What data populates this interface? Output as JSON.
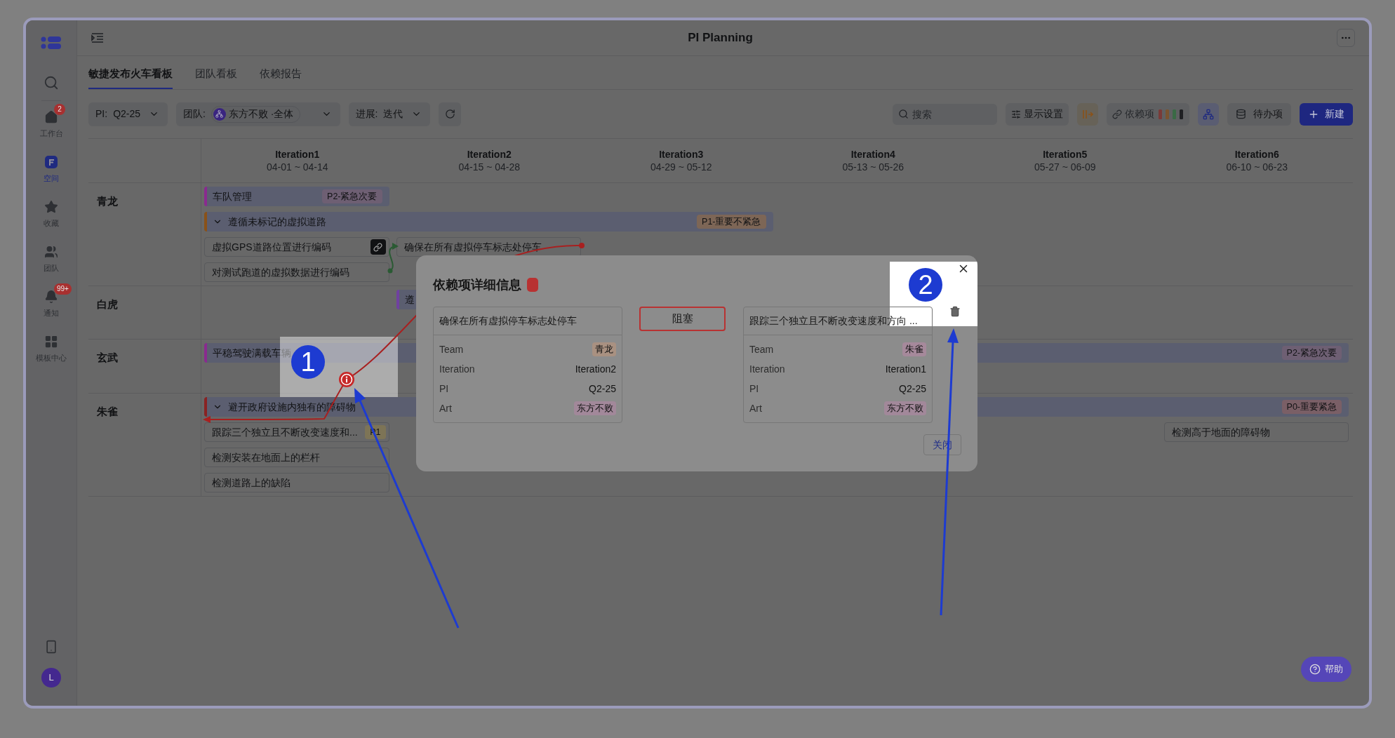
{
  "window": {
    "title": "PI Planning"
  },
  "sidebar": {
    "items": [
      {
        "label": "工作台",
        "badge": "2",
        "selected": false
      },
      {
        "label": "空间",
        "selected": true
      },
      {
        "label": "收藏",
        "selected": false
      },
      {
        "label": "团队",
        "selected": false
      },
      {
        "label": "通知",
        "badge": "99+",
        "selected": false
      },
      {
        "label": "模板中心",
        "selected": false
      }
    ],
    "avatar": "L"
  },
  "tabs": [
    {
      "label": "敏捷发布火车看板",
      "selected": true
    },
    {
      "label": "团队看板",
      "selected": false
    },
    {
      "label": "依赖报告",
      "selected": false
    }
  ],
  "filters": [
    {
      "label": "PI:",
      "value": "Q2-25"
    },
    {
      "label": "团队:",
      "value": "东方不败 ·全体"
    },
    {
      "label": "进展:",
      "value": "迭代"
    }
  ],
  "toolbar": {
    "search": {
      "placeholder": "搜索"
    },
    "buttons": [
      {
        "label": "显示设置"
      },
      {
        "label": "依赖项"
      },
      {
        "label": "待办项"
      },
      {
        "label": "新建"
      }
    ]
  },
  "board": {
    "columns": [
      {
        "name": "Iteration1",
        "dates": "04-01 ~ 04-14"
      },
      {
        "name": "Iteration2",
        "dates": "04-15 ~ 04-28"
      },
      {
        "name": "Iteration3",
        "dates": "04-29 ~ 05-12"
      },
      {
        "name": "Iteration4",
        "dates": "05-13 ~ 05-26"
      },
      {
        "name": "Iteration5",
        "dates": "05-27 ~ 06-09"
      },
      {
        "name": "Iteration6",
        "dates": "06-10 ~ 06-23"
      }
    ],
    "lanes": [
      {
        "name": "青龙",
        "rows": [
          [
            {
              "kind": "bar",
              "text": "车队管理",
              "color": "#8a2a8f",
              "tag": {
                "text": "P2-紧急次要",
                "color": "#6e5f73"
              }
            }
          ],
          [
            {
              "kind": "group",
              "text": "遵循未标记的虚拟道路",
              "color": "#8a5218",
              "expanded": true,
              "tag": {
                "text": "P1-重要不紧急",
                "color": "#7d6656"
              }
            }
          ],
          [
            {
              "kind": "card",
              "text": "虚拟GPS道路位置进行编码",
              "linked": true
            },
            {
              "kind": "card",
              "text": "确保在所有虚拟停车标志处停车",
              "linked": false
            }
          ],
          [
            {
              "kind": "card",
              "text": "对测试跑道的虚拟数据进行编码",
              "linked": false
            }
          ]
        ]
      },
      {
        "name": "白虎",
        "rows": [
          [
            {
              "kind": "bar",
              "text": "遵",
              "color": "#7040a0"
            }
          ]
        ]
      },
      {
        "name": "玄武",
        "rows": [
          [
            {
              "kind": "bar",
              "text": "平稳驾驶满载车辆",
              "color": "#8a2a8f",
              "tag": {
                "text": "P2-紧急次要",
                "color": "#6e5f73"
              }
            }
          ]
        ]
      },
      {
        "name": "朱雀",
        "rows": [
          [
            {
              "kind": "group",
              "text": "避开政府设施内独有的障碍物",
              "color": "#8a2222",
              "expanded": true,
              "tag": {
                "text": "P0-重要紧急",
                "color": "#7a5f66"
              }
            }
          ],
          [
            {
              "kind": "card",
              "text": "跟踪三个独立且不断改变速度和...",
              "linked": false,
              "tag": {
                "text": "P1",
                "color": "#7d7456"
              }
            },
            {
              "kind": "card",
              "text": "检测高于地面的障碍物",
              "linked": false
            }
          ],
          [
            {
              "kind": "card",
              "text": "检测安装在地面上的栏杆",
              "linked": false
            }
          ],
          [
            {
              "kind": "card",
              "text": "检测道路上的缺陷",
              "linked": false
            }
          ]
        ]
      }
    ]
  },
  "dialog": {
    "title": "依赖项详细信息",
    "color": "#b83232",
    "relation": "阻塞",
    "items": [
      {
        "title": "确保在所有虚拟停车标志处停车",
        "fields": [
          {
            "label": "Team",
            "value": "青龙",
            "kind": "tag",
            "color": "#a99181"
          },
          {
            "label": "Iteration",
            "value": "Iteration2",
            "kind": "text"
          },
          {
            "label": "PI",
            "value": "Q2-25",
            "kind": "text"
          },
          {
            "label": "Art",
            "value": "东方不败",
            "kind": "tag",
            "color": "#a2889a"
          }
        ]
      },
      {
        "title": "跟踪三个独立且不断改变速度和方向 ...",
        "fields": [
          {
            "label": "Team",
            "value": "朱雀",
            "kind": "tag",
            "color": "#a6899b"
          },
          {
            "label": "Iteration",
            "value": "Iteration1",
            "kind": "text"
          },
          {
            "label": "PI",
            "value": "Q2-25",
            "kind": "text"
          },
          {
            "label": "Art",
            "value": "东方不败",
            "kind": "tag",
            "color": "#a2889a"
          }
        ]
      }
    ],
    "close_button": "关闭"
  },
  "help": {
    "label": "帮助"
  },
  "annotations": {
    "callouts": [
      "1",
      "2"
    ]
  }
}
